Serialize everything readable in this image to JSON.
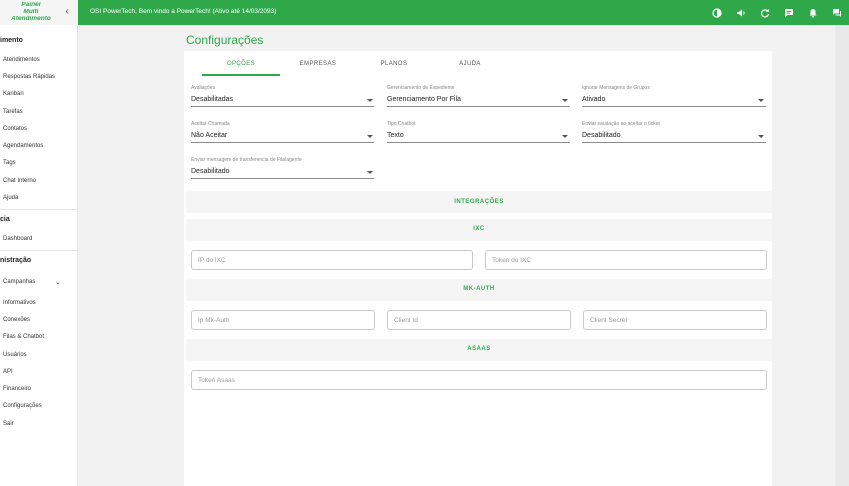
{
  "colors": {
    "accent": "#2fa84a",
    "brand_bg": "#f5f5f5",
    "topbar": "#2fa84a"
  },
  "brand": {
    "line1": "Painel",
    "line2": "Multi",
    "line3": "Atendimento"
  },
  "header": {
    "welcome": "OSI PowerTech, Bem vindo a PowerTech! (Ativo até 14/03/2093)",
    "icons": [
      "contrast-icon",
      "volume-icon",
      "refresh-icon",
      "chat-icon",
      "bell-icon",
      "messages-icon"
    ]
  },
  "sidebar": {
    "section1": "imento",
    "items1": [
      "Atendimentos",
      "Respostas Rápidas",
      "Kanban",
      "Tarefas",
      "Contatos",
      "Agendamentos",
      "Tags",
      "Chat Interno",
      "Ajuda"
    ],
    "section2": "cia",
    "items2": [
      "Dashboard"
    ],
    "section3": "nistração",
    "campaigns": "Campanhas",
    "items3": [
      "Informativos",
      "Conexões",
      "Filas & Chatbot",
      "Usuários",
      "API",
      "Financeiro",
      "Configurações",
      "Sair"
    ]
  },
  "page": {
    "title": "Configurações"
  },
  "tabs": [
    "OPÇÕES",
    "EMPRESAS",
    "PLANOS",
    "AJUDA"
  ],
  "options": [
    {
      "label": "Avaliações",
      "value": "Desabilitadas"
    },
    {
      "label": "Gerenciamento de Expediente",
      "value": "Gerenciamento Por Fila"
    },
    {
      "label": "Ignorar Mensagens de Grupos",
      "value": "Ativado"
    },
    {
      "label": "Aceitar Chamada",
      "value": "Não Aceitar"
    },
    {
      "label": "Tipo Chatbot",
      "value": "Texto"
    },
    {
      "label": "Enviar saudação ao aceitar o ticket",
      "value": "Desabilitado"
    },
    {
      "label": "Enviar mensagem de transferencia de Fila/agente",
      "value": "Desabilitado"
    }
  ],
  "integrations": {
    "title": "INTEGRAÇÕES",
    "ixc": {
      "title": "IXC",
      "ip_placeholder": "IP do IXC",
      "token_placeholder": "Token do IXC"
    },
    "mkauth": {
      "title": "MK-AUTH",
      "ip_placeholder": "Ip Mk-Auth",
      "client_id_placeholder": "Client Id",
      "client_secret_placeholder": "Client Secret"
    },
    "asaas": {
      "title": "ASAAS",
      "token_placeholder": "Token Asaas"
    }
  }
}
